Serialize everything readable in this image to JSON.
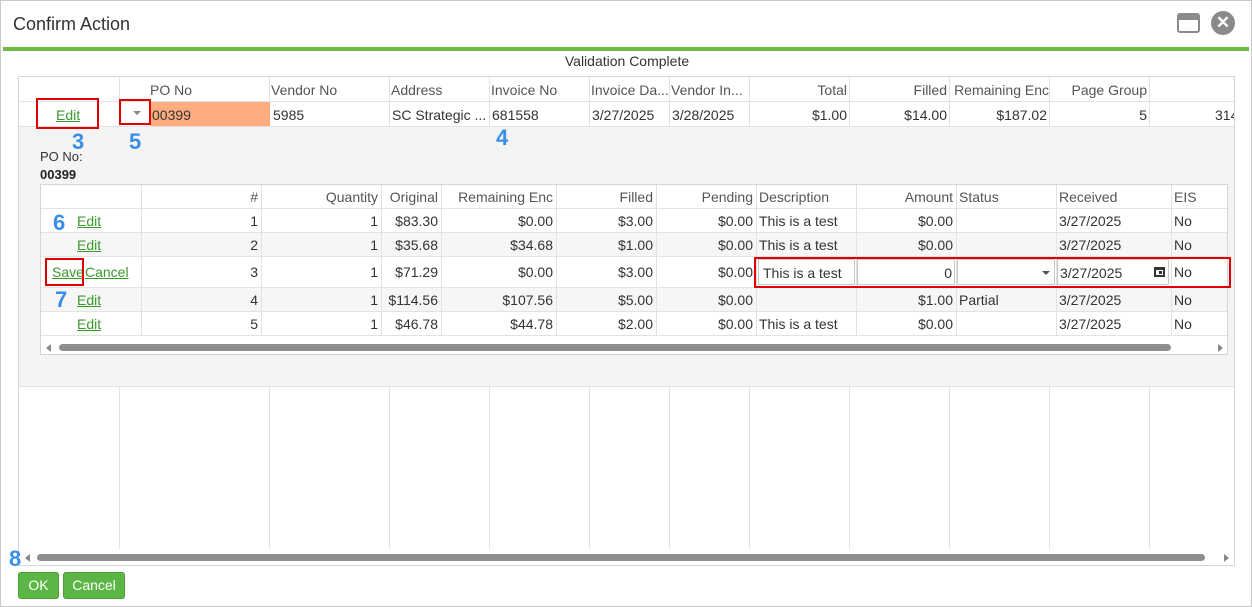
{
  "window": {
    "title": "Confirm Action",
    "status_text": "Validation Complete"
  },
  "main_table": {
    "headers": [
      "",
      "PO No",
      "Vendor No",
      "Address",
      "Invoice No",
      "Invoice Da...",
      "Vendor In...",
      "Total",
      "Filled",
      "Remaining Enc",
      "Page Group",
      ""
    ],
    "row": {
      "edit_label": "Edit",
      "po_no": "00399",
      "vendor_no": "5985",
      "address": "SC Strategic ...",
      "invoice_no": "681558",
      "invoice_date": "3/27/2025",
      "vendor_invoice_date": "3/28/2025",
      "total": "$1.00",
      "filled": "$14.00",
      "remaining_enc": "$187.02",
      "page_group": "5",
      "extra": "314"
    }
  },
  "detail": {
    "po_label": "PO No:",
    "po_value": "00399",
    "headers": [
      "",
      "#",
      "Quantity",
      "Original",
      "Remaining Enc",
      "Filled",
      "Pending",
      "Description",
      "Amount",
      "Status",
      "Received",
      "EIS"
    ],
    "rows": [
      {
        "action": "Edit",
        "num": "1",
        "quantity": "1",
        "original": "$83.30",
        "remaining": "$0.00",
        "filled": "$3.00",
        "pending": "$0.00",
        "description": "This is a test",
        "amount": "$0.00",
        "status": "",
        "received": "3/27/2025",
        "eis": "No"
      },
      {
        "action": "Edit",
        "num": "2",
        "quantity": "1",
        "original": "$35.68",
        "remaining": "$34.68",
        "filled": "$1.00",
        "pending": "$0.00",
        "description": "This is a test",
        "amount": "$0.00",
        "status": "",
        "received": "3/27/2025",
        "eis": "No"
      },
      {
        "action": "Save",
        "action2": "Cancel",
        "num": "3",
        "quantity": "1",
        "original": "$71.29",
        "remaining": "$0.00",
        "filled": "$3.00",
        "pending": "$0.00",
        "description": "This is a test",
        "amount": "0",
        "status": "",
        "received": "3/27/2025",
        "eis": "No"
      },
      {
        "action": "Edit",
        "num": "4",
        "quantity": "1",
        "original": "$114.56",
        "remaining": "$107.56",
        "filled": "$5.00",
        "pending": "$0.00",
        "description": "",
        "amount": "$1.00",
        "status": "Partial",
        "received": "3/27/2025",
        "eis": "No"
      },
      {
        "action": "Edit",
        "num": "5",
        "quantity": "1",
        "original": "$46.78",
        "remaining": "$44.78",
        "filled": "$2.00",
        "pending": "$0.00",
        "description": "This is a test",
        "amount": "$0.00",
        "status": "",
        "received": "3/27/2025",
        "eis": "No"
      }
    ]
  },
  "annotations": [
    "3",
    "4",
    "5",
    "6",
    "7",
    "8"
  ],
  "buttons": {
    "ok": "OK",
    "cancel": "Cancel"
  },
  "colors": {
    "accent_green": "#6fbc45",
    "button_green": "#5cb645",
    "highlight_red": "#e00000",
    "po_highlight": "#ffad80",
    "annotation_blue": "#3a8ee6"
  }
}
